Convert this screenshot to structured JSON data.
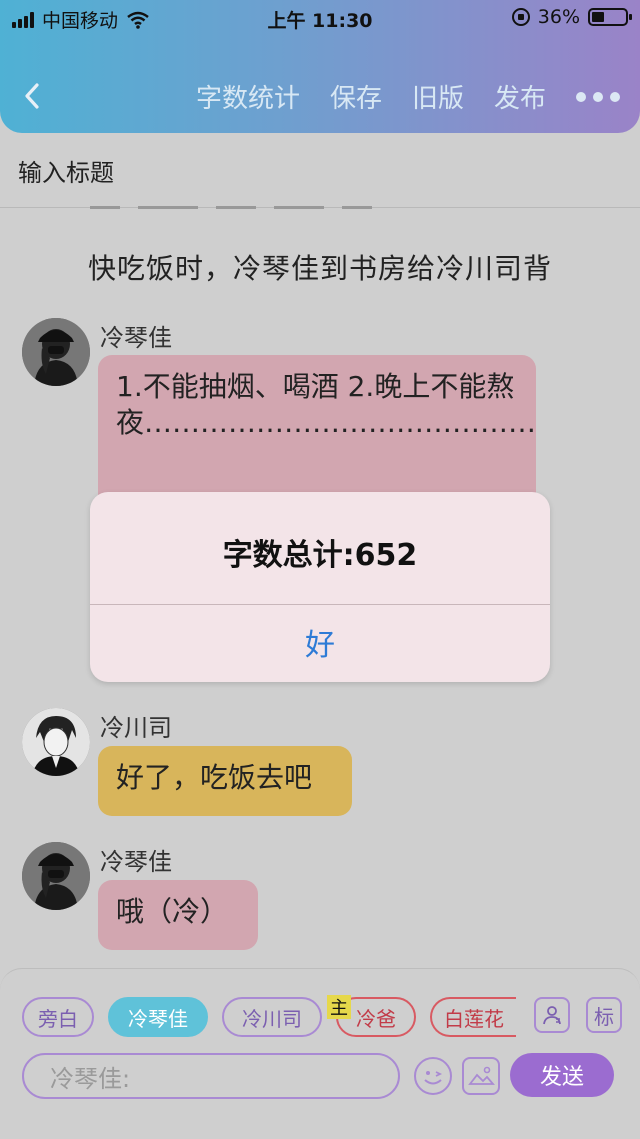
{
  "status_bar": {
    "carrier": "中国移动",
    "time": "上午 11:30",
    "battery": "36%"
  },
  "navbar": {
    "actions": [
      "字数统计",
      "保存",
      "旧版",
      "发布"
    ]
  },
  "title_input": {
    "placeholder": "输入标题"
  },
  "narration": "快吃饭时，冷琴佳到书房给冷川司背",
  "messages": [
    {
      "sender": "冷琴佳",
      "text": "1.不能抽烟、喝酒 2.晚上不能熬夜……………………………………",
      "color": "#d2a6b0"
    },
    {
      "sender": "冷川司",
      "text": "好了，吃饭去吧",
      "color": "#d8b55b"
    },
    {
      "sender": "冷琴佳",
      "text": "哦（冷）",
      "color": "#d2a6b0"
    }
  ],
  "dialog": {
    "title": "字数总计:652",
    "ok_label": "好"
  },
  "characters": {
    "narrator": "旁白",
    "active": "冷琴佳",
    "chuansi": "冷川司",
    "main_tag": "主",
    "dad": "冷爸",
    "lotus": "白莲花",
    "tag_btn": "标"
  },
  "composer": {
    "placeholder": "冷琴佳:",
    "send_label": "发送"
  },
  "colors": {
    "header_start": "#4fb1d4",
    "header_end": "#9a83c8",
    "accent_purple": "#9b6cd0",
    "active_chip": "#5fc2d9",
    "dialog_link": "#2d7bd6"
  }
}
